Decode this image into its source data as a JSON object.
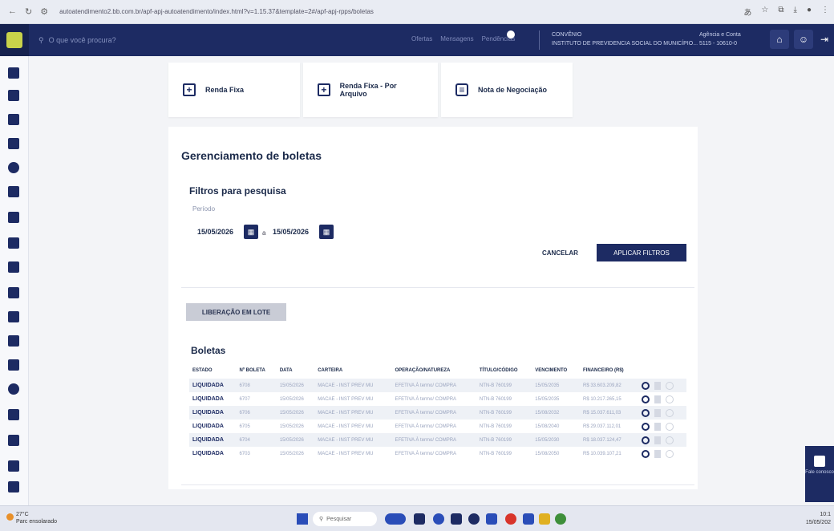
{
  "browser": {
    "url": "autoatendimento2.bb.com.br/apf-apj-autoatendimento/index.html?v=1.15.37&template=2#/apf-apj-rpps/boletas"
  },
  "header": {
    "search_placeholder": "O que você procura?",
    "links": [
      "Ofertas",
      "Mensagens",
      "Pendências"
    ],
    "bell_count": "0",
    "institution_label": "CONVÊNIO",
    "institution": "INSTITUTO DE PREVIDENCIA SOCIAL DO MUNICÍPIO...",
    "agency_label": "Agência e Conta",
    "agency": "5115 - 10610-0"
  },
  "quick_actions": [
    {
      "label": "Renda Fixa",
      "icon": "plus-square-icon"
    },
    {
      "label": "Renda Fixa - Por Arquivo",
      "icon": "plus-square-icon"
    },
    {
      "label": "Nota de Negociação",
      "icon": "document-icon"
    }
  ],
  "page": {
    "title": "Gerenciamento de boletas",
    "filters_title": "Filtros para pesquisa",
    "period_label": "Período",
    "date_from": "15/05/2026",
    "date_sep": "a",
    "date_to": "15/05/2026",
    "cancel_label": "CANCELAR",
    "apply_label": "APLICAR FILTROS",
    "batch_label": "LIBERAÇÃO EM LOTE",
    "boletas_title": "Boletas"
  },
  "table": {
    "columns": [
      "ESTADO",
      "Nº BOLETA",
      "DATA",
      "CARTEIRA",
      "OPERAÇÃO/NATUREZA",
      "TÍTULO/CÓDIGO",
      "VENCIMENTO",
      "FINANCEIRO (R$)"
    ],
    "rows": [
      {
        "status": "LIQUIDADA",
        "num": "6708",
        "date": "15/05/2026",
        "wallet": "MACAE - INST PREV MU",
        "op": "EFETIVA À termo/ COMPRA",
        "code": "NTN-B 760199",
        "due": "15/05/2035",
        "value": "R$ 33.603.209,82"
      },
      {
        "status": "LIQUIDADA",
        "num": "6707",
        "date": "15/05/2026",
        "wallet": "MACAE - INST PREV MU",
        "op": "EFETIVA À termo/ COMPRA",
        "code": "NTN-B 760199",
        "due": "15/05/2035",
        "value": "R$ 10.217.265,15"
      },
      {
        "status": "LIQUIDADA",
        "num": "6706",
        "date": "15/05/2026",
        "wallet": "MACAE - INST PREV MU",
        "op": "EFETIVA À termo/ COMPRA",
        "code": "NTN-B 760199",
        "due": "15/08/2032",
        "value": "R$ 15.037.611,03"
      },
      {
        "status": "LIQUIDADA",
        "num": "6705",
        "date": "15/05/2026",
        "wallet": "MACAE - INST PREV MU",
        "op": "EFETIVA À termo/ COMPRA",
        "code": "NTN-B 760199",
        "due": "15/08/2040",
        "value": "R$ 29.037.112,01"
      },
      {
        "status": "LIQUIDADA",
        "num": "6704",
        "date": "15/05/2026",
        "wallet": "MACAE - INST PREV MU",
        "op": "EFETIVA À termo/ COMPRA",
        "code": "NTN-B 760199",
        "due": "15/05/2030",
        "value": "R$ 18.037.124,47"
      },
      {
        "status": "LIQUIDADA",
        "num": "6703",
        "date": "15/05/2026",
        "wallet": "MACAE - INST PREV MU",
        "op": "EFETIVA À termo/ COMPRA",
        "code": "NTN-B 760199",
        "due": "15/08/2050",
        "value": "R$ 10.039.107,21"
      }
    ]
  },
  "chat": {
    "label": "Fale conosco"
  },
  "taskbar": {
    "weather_temp": "27°C",
    "weather_desc": "Parc ensolarado",
    "search_label": "Pesquisar",
    "time": "10:1",
    "date": "15/05/202"
  },
  "colors": {
    "primary": "#1d2b63",
    "accent": "#c8d24a"
  }
}
